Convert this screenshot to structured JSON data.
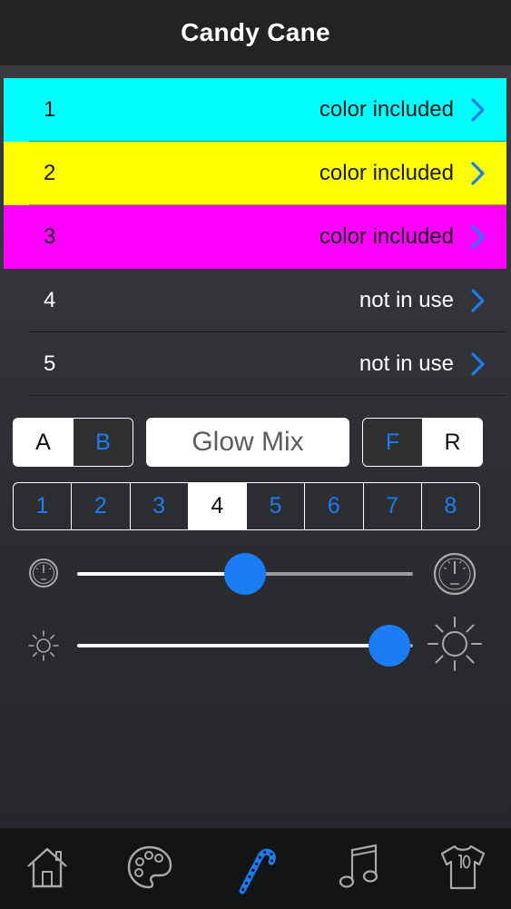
{
  "nav": {
    "title": "Candy Cane"
  },
  "slots": [
    {
      "number": "1",
      "status": "color included",
      "color": "#00ffff"
    },
    {
      "number": "2",
      "status": "color included",
      "color": "#ffff00"
    },
    {
      "number": "3",
      "status": "color included",
      "color": "#ff00ff"
    },
    {
      "number": "4",
      "status": "not in use",
      "color": ""
    },
    {
      "number": "5",
      "status": "not in use",
      "color": ""
    }
  ],
  "controls": {
    "ab": {
      "a_label": "A",
      "b_label": "B",
      "selected": "A"
    },
    "mode_label": "Glow Mix",
    "fr": {
      "f_label": "F",
      "r_label": "R",
      "selected": "R"
    },
    "numbers": [
      "1",
      "2",
      "3",
      "4",
      "5",
      "6",
      "7",
      "8"
    ],
    "selected_number": "4"
  },
  "speed_slider": {
    "value": 0.5,
    "min_icon": "speedometer-slow-icon",
    "max_icon": "speedometer-fast-icon"
  },
  "brightness_slider": {
    "value": 0.93,
    "min_icon": "brightness-low-icon",
    "max_icon": "brightness-high-icon"
  },
  "tabs": [
    {
      "icon": "home-icon",
      "active": false
    },
    {
      "icon": "palette-icon",
      "active": false
    },
    {
      "icon": "candy-cane-icon",
      "active": true
    },
    {
      "icon": "music-note-icon",
      "active": false
    },
    {
      "icon": "jersey-icon",
      "active": false
    }
  ],
  "colors": {
    "accent": "#1c7cf4",
    "background": "#2f3032",
    "tabbar": "#131415"
  }
}
